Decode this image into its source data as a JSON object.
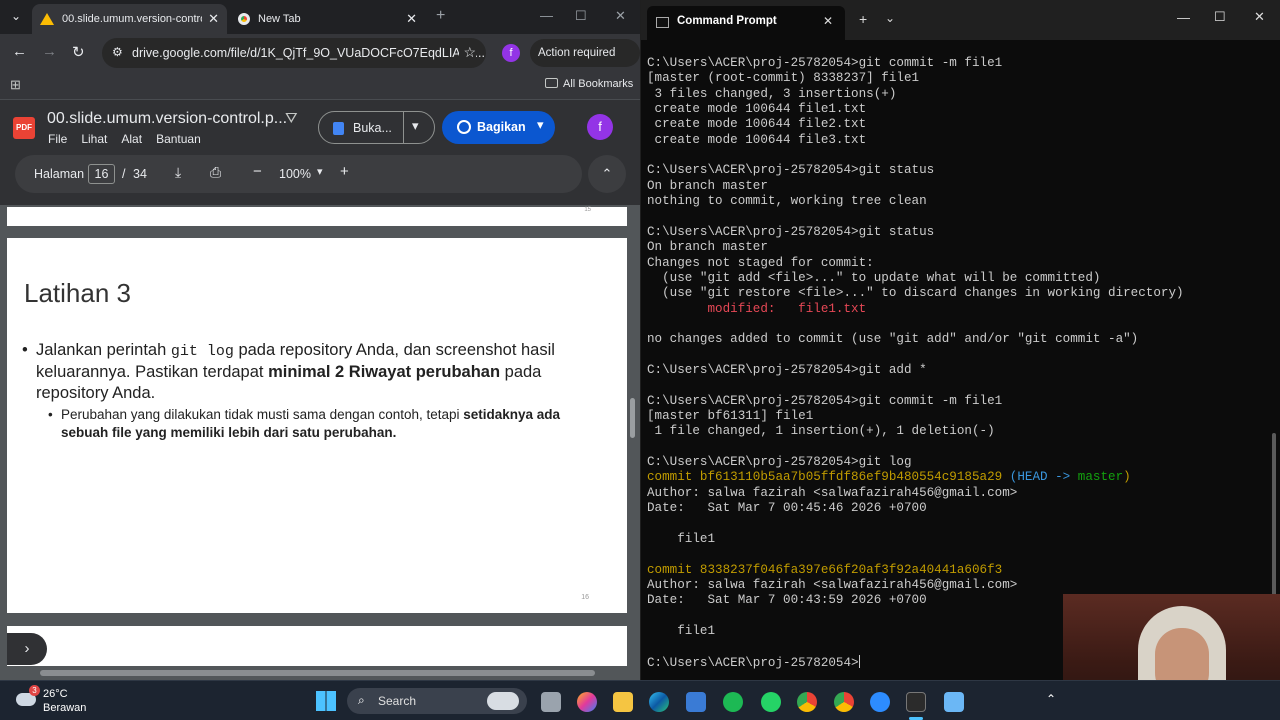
{
  "browser": {
    "tabs": [
      {
        "title": "00.slide.umum.version-control.p",
        "active": true
      },
      {
        "title": "New Tab",
        "active": false
      }
    ],
    "url": "drive.google.com/file/d/1K_QjTf_9O_VUaDOCFcO7EqdLIAtM...",
    "profile_initial": "f",
    "action_required": "Action required",
    "all_bookmarks": "All Bookmarks"
  },
  "doc": {
    "title": "00.slide.umum.version-control.p...",
    "menu": [
      "File",
      "Lihat",
      "Alat",
      "Bantuan"
    ],
    "open_with": "Buka...",
    "share": "Bagikan",
    "avatar": "f"
  },
  "pdf": {
    "page_label": "Halaman",
    "current_page": "16",
    "separator": "/",
    "total_pages": "34",
    "zoom": "100%",
    "prev_page_number": "15",
    "page_number": "16"
  },
  "slide": {
    "title": "Latihan 3",
    "bullet1_pre": "Jalankan perintah ",
    "bullet1_code": "git log",
    "bullet1_mid": " pada repository Anda, dan screenshot hasil keluarannya. Pastikan terdapat ",
    "bullet1_bold": "minimal 2 Riwayat perubahan",
    "bullet1_post": " pada repository Anda.",
    "sub_pre": "Perubahan yang dilakukan tidak musti sama dengan contoh, tetapi ",
    "sub_bold": "setidaknya ada sebuah file yang memiliki lebih dari satu perubahan."
  },
  "terminal": {
    "tab_title": "Command Prompt",
    "lines": [
      {
        "t": "C:\\Users\\ACER\\proj-25782054>git commit -m file1"
      },
      {
        "t": "[master (root-commit) 8338237] file1"
      },
      {
        "t": " 3 files changed, 3 insertions(+)"
      },
      {
        "t": " create mode 100644 file1.txt"
      },
      {
        "t": " create mode 100644 file2.txt"
      },
      {
        "t": " create mode 100644 file3.txt"
      },
      {
        "t": ""
      },
      {
        "t": "C:\\Users\\ACER\\proj-25782054>git status"
      },
      {
        "t": "On branch master"
      },
      {
        "t": "nothing to commit, working tree clean"
      },
      {
        "t": ""
      },
      {
        "t": "C:\\Users\\ACER\\proj-25782054>git status"
      },
      {
        "t": "On branch master"
      },
      {
        "t": "Changes not staged for commit:"
      },
      {
        "t": "  (use \"git add <file>...\" to update what will be committed)"
      },
      {
        "t": "  (use \"git restore <file>...\" to discard changes in working directory)"
      },
      {
        "t": "        modified:   file1.txt",
        "c": "#e74856"
      },
      {
        "t": ""
      },
      {
        "t": "no changes added to commit (use \"git add\" and/or \"git commit -a\")"
      },
      {
        "t": ""
      },
      {
        "t": "C:\\Users\\ACER\\proj-25782054>git add *"
      },
      {
        "t": ""
      },
      {
        "t": "C:\\Users\\ACER\\proj-25782054>git commit -m file1"
      },
      {
        "t": "[master bf61311] file1"
      },
      {
        "t": " 1 file changed, 1 insertion(+), 1 deletion(-)"
      },
      {
        "t": ""
      },
      {
        "t": "C:\\Users\\ACER\\proj-25782054>git log"
      },
      {
        "t": "commit bf613110b5aa7b05ffdf86ef9b480554c9185a29 ",
        "c": "#c19c00",
        "t2": "(HEAD -> ",
        "c2": "#3a96dd",
        "t3": "master",
        "c3": "#13a10e",
        "t4": ")",
        "c4": "#c19c00"
      },
      {
        "t": "Author: salwa fazirah <salwafazirah456@gmail.com>"
      },
      {
        "t": "Date:   Sat Mar 7 00:45:46 2026 +0700"
      },
      {
        "t": ""
      },
      {
        "t": "    file1"
      },
      {
        "t": ""
      },
      {
        "t": "commit 8338237f046fa397e66f20af3f92a40441a606f3",
        "c": "#c19c00"
      },
      {
        "t": "Author: salwa fazirah <salwafazirah456@gmail.com>"
      },
      {
        "t": "Date:   Sat Mar 7 00:43:59 2026 +0700"
      },
      {
        "t": ""
      },
      {
        "t": "    file1"
      },
      {
        "t": ""
      },
      {
        "t": "C:\\Users\\ACER\\proj-25782054>"
      }
    ]
  },
  "taskbar": {
    "temperature": "26°C",
    "weather": "Berawan",
    "search": "Search",
    "weather_badge": "3"
  },
  "colors": {
    "chrome_bg": "#202124",
    "share_blue": "#0b57d0",
    "avatar_purple": "#9334e6",
    "terminal_bg": "#0c0c0c",
    "git_yellow": "#c19c00",
    "git_red": "#e74856"
  }
}
